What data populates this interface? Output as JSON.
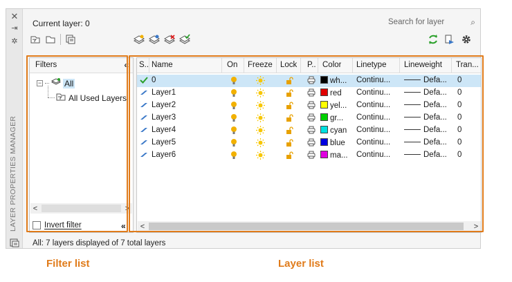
{
  "window": {
    "current_layer": "Current layer: 0",
    "search_placeholder": "Search for layer",
    "vertical_title": "LAYER PROPERTIES MANAGER",
    "status": "All: 7 layers displayed of 7 total layers"
  },
  "filters": {
    "header": "Filters",
    "tree_all": "All",
    "tree_used": "All Used Layers",
    "invert_label": "Invert filter"
  },
  "layers": {
    "columns": [
      "S..",
      "Name",
      "On",
      "Freeze",
      "Lock",
      "P..",
      "Color",
      "Linetype",
      "Lineweight",
      "Tran..."
    ],
    "rows": [
      {
        "name": "0",
        "color_name": "wh...",
        "swatch": "#000000",
        "linetype": "Continu...",
        "lineweight": "Defa...",
        "trans": "0",
        "current": true
      },
      {
        "name": "Layer1",
        "color_name": "red",
        "swatch": "#e00000",
        "linetype": "Continu...",
        "lineweight": "Defa...",
        "trans": "0",
        "current": false
      },
      {
        "name": "Layer2",
        "color_name": "yel...",
        "swatch": "#ffff00",
        "linetype": "Continu...",
        "lineweight": "Defa...",
        "trans": "0",
        "current": false
      },
      {
        "name": "Layer3",
        "color_name": "gr...",
        "swatch": "#00d000",
        "linetype": "Continu...",
        "lineweight": "Defa...",
        "trans": "0",
        "current": false
      },
      {
        "name": "Layer4",
        "color_name": "cyan",
        "swatch": "#00e0e0",
        "linetype": "Continu...",
        "lineweight": "Defa...",
        "trans": "0",
        "current": false
      },
      {
        "name": "Layer5",
        "color_name": "blue",
        "swatch": "#0000e0",
        "linetype": "Continu...",
        "lineweight": "Defa...",
        "trans": "0",
        "current": false
      },
      {
        "name": "Layer6",
        "color_name": "ma...",
        "swatch": "#e000e0",
        "linetype": "Continu...",
        "lineweight": "Defa...",
        "trans": "0",
        "current": false
      }
    ]
  },
  "captions": {
    "filter_list": "Filter list",
    "layer_list": "Layer list"
  },
  "colors": {
    "accent_frame": "#e07b1a",
    "selection": "#cde6f7",
    "bulb": "#f2b100",
    "sun": "#f7c600",
    "lock": "#e8a100",
    "current_check": "#2aa02a",
    "layer_icon": "#3a78c8"
  },
  "icons": {
    "close": "close-icon",
    "pin": "pin-icon",
    "settings": "gear-icon",
    "search": "search-icon",
    "refresh": "refresh-icon"
  }
}
